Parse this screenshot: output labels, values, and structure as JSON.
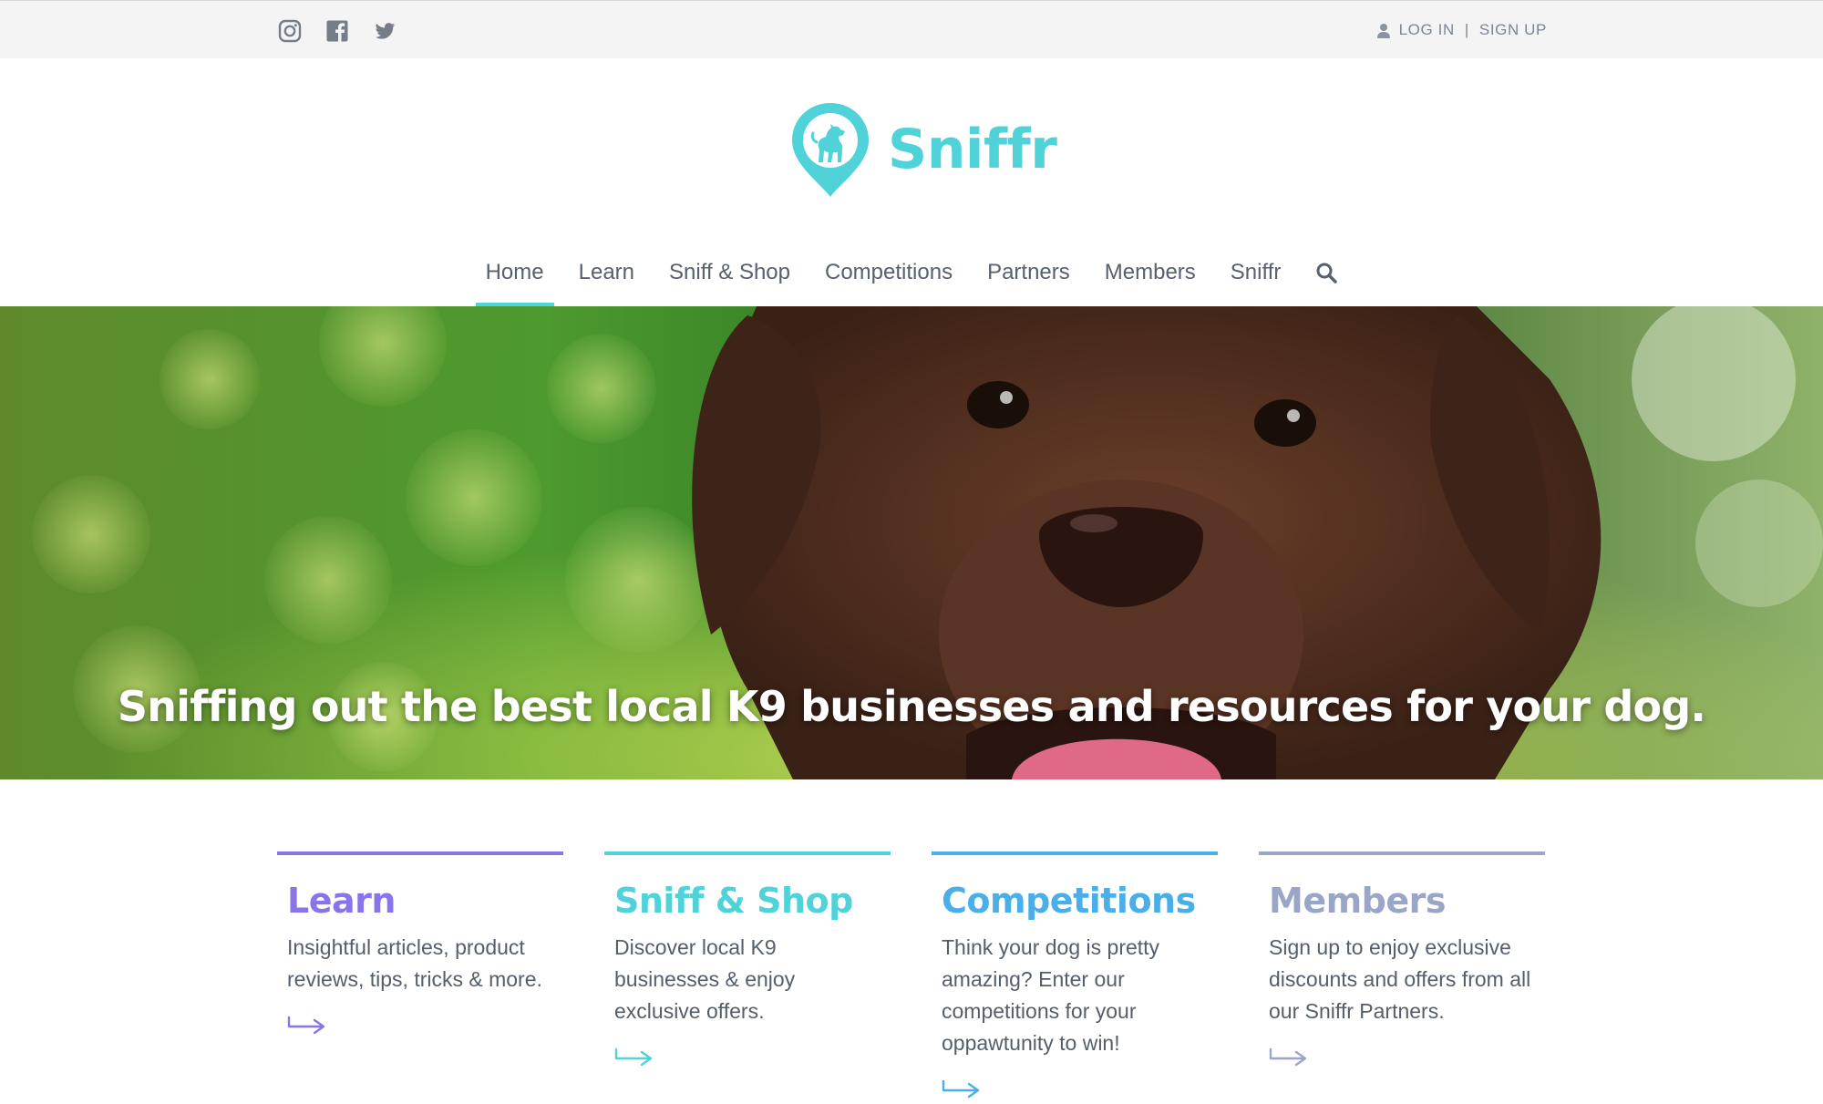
{
  "topbar": {
    "social": [
      {
        "name": "instagram-icon"
      },
      {
        "name": "facebook-icon"
      },
      {
        "name": "twitter-icon"
      }
    ],
    "login_label": "LOG IN",
    "signup_label": "SIGN UP",
    "separator": "|"
  },
  "brand": {
    "name": "Sniffr",
    "color": "#4fd3d8"
  },
  "nav": {
    "items": [
      "Home",
      "Learn",
      "Sniff & Shop",
      "Competitions",
      "Partners",
      "Members",
      "Sniffr"
    ],
    "active": "Home",
    "search_icon": "search-icon"
  },
  "hero": {
    "tagline": "Sniffing out the best local K9 businesses and resources for your dog."
  },
  "cards": [
    {
      "title": "Learn",
      "text": "Insightful articles, product reviews, tips, tricks & more.",
      "color": "#8b73ea"
    },
    {
      "title": "Sniff & Shop",
      "text": "Discover local K9 businesses & enjoy exclusive offers.",
      "color": "#4fd3d8"
    },
    {
      "title": "Competitions",
      "text": "Think your dog is pretty amazing? Enter our competitions for your oppawtunity to win!",
      "color": "#4aaee8"
    },
    {
      "title": "Members",
      "text": "Sign up to enjoy exclusive discounts and offers from all our Sniffr Partners.",
      "color": "#9aa6c8"
    }
  ]
}
